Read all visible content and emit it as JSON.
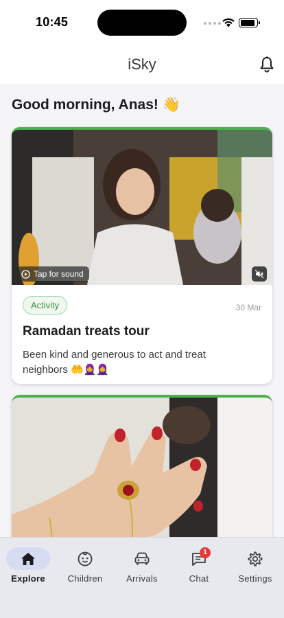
{
  "status": {
    "time": "10:45"
  },
  "header": {
    "title": "iSky"
  },
  "greeting": "Good morning, Anas! 👋",
  "posts": [
    {
      "tag": "Activity",
      "date": "30 Mar",
      "title": "Ramadan treats tour",
      "description": "Been kind and generous to act and treat neighbors 🤲🧕🧕",
      "sound_label": "Tap for sound"
    }
  ],
  "nav": [
    {
      "label": "Explore",
      "icon": "home-icon",
      "active": true
    },
    {
      "label": "Children",
      "icon": "face-icon"
    },
    {
      "label": "Arrivals",
      "icon": "car-icon"
    },
    {
      "label": "Chat",
      "icon": "chat-icon",
      "badge": "1"
    },
    {
      "label": "Settings",
      "icon": "gear-icon"
    }
  ],
  "colors": {
    "accent": "#4caf50",
    "nav_active": "#d7dcf3",
    "badge": "#e53935"
  }
}
